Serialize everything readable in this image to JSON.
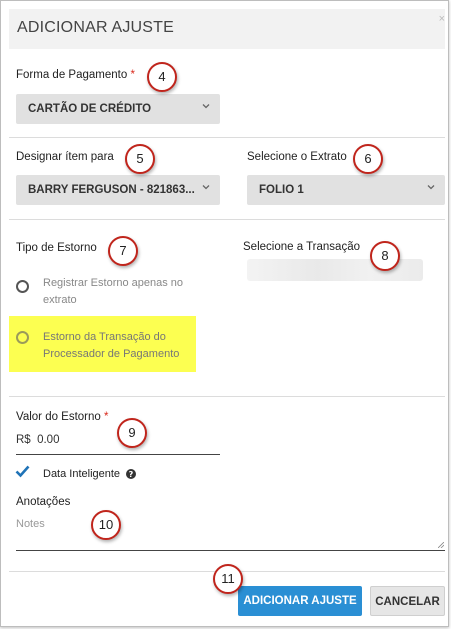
{
  "dialog": {
    "title": "ADICIONAR AJUSTE",
    "close_glyph": "×"
  },
  "payment": {
    "label": "Forma de Pagamento",
    "required_mark": "*",
    "value": "CARTÃO DE CRÉDITO"
  },
  "assign": {
    "label": "Designar ítem para",
    "value": "BARRY FERGUSON - 821863..."
  },
  "statement": {
    "label": "Selecione o Extrato",
    "value": "FOLIO 1"
  },
  "refund_type": {
    "label": "Tipo de Estorno",
    "options": [
      {
        "line1": "Registrar Estorno apenas no",
        "line2": "extrato"
      },
      {
        "line1": "Estorno da Transação do",
        "line2": "Processador de Pagamento"
      }
    ]
  },
  "transaction": {
    "label": "Selecione a Transação"
  },
  "amount": {
    "label": "Valor do Estorno",
    "required_mark": "*",
    "value": "R$  0.00"
  },
  "smart_date": {
    "label": "Data Inteligente"
  },
  "notes": {
    "label": "Anotações",
    "placeholder": "Notes"
  },
  "buttons": {
    "submit": "ADICIONAR AJUSTE",
    "cancel": "CANCELAR"
  },
  "annotation_badges": [
    "4",
    "5",
    "6",
    "7",
    "8",
    "9",
    "10",
    "11"
  ],
  "colors": {
    "primary_button": "#2a8fd4",
    "highlight": "#fcff51",
    "required": "#d9291c",
    "badge_border": "#c0251c",
    "check": "#1f73b7"
  }
}
